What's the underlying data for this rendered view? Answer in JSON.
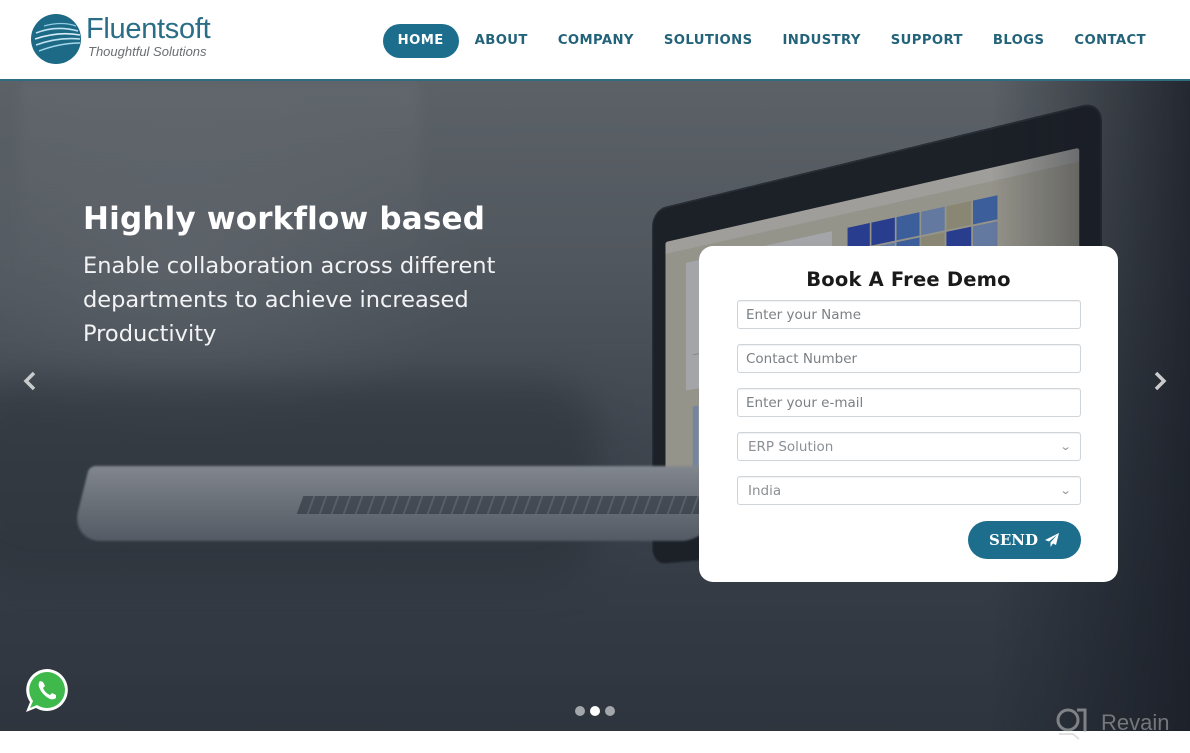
{
  "brand": {
    "name": "Fluentsoft",
    "tagline": "Thoughtful Solutions",
    "primary_color": "#1c6e8c",
    "nav_text_color": "#23637a"
  },
  "nav": {
    "items": [
      {
        "label": "HOME",
        "active": true
      },
      {
        "label": "ABOUT",
        "active": false
      },
      {
        "label": "COMPANY",
        "active": false
      },
      {
        "label": "SOLUTIONS",
        "active": false
      },
      {
        "label": "INDUSTRY",
        "active": false
      },
      {
        "label": "SUPPORT",
        "active": false
      },
      {
        "label": "BLOGS",
        "active": false
      },
      {
        "label": "CONTACT",
        "active": false
      }
    ]
  },
  "hero": {
    "title": "Highly workflow based",
    "text": "Enable collaboration across different departments to achieve increased Productivity",
    "prev_icon": "chevron-left-icon",
    "next_icon": "chevron-right-icon",
    "slides_total": 3,
    "active_slide": 2
  },
  "demo_form": {
    "title": "Book A Free Demo",
    "name_placeholder": "Enter your Name",
    "contact_placeholder": "Contact Number",
    "email_placeholder": "Enter your e-mail",
    "solution_selected": "ERP Solution",
    "country_selected": "India",
    "send_label": "SEND",
    "send_icon": "paper-plane-icon"
  },
  "floating": {
    "whatsapp_icon": "whatsapp-icon",
    "whatsapp_color": "#3fb94c"
  },
  "watermark": {
    "text": "Revain"
  }
}
